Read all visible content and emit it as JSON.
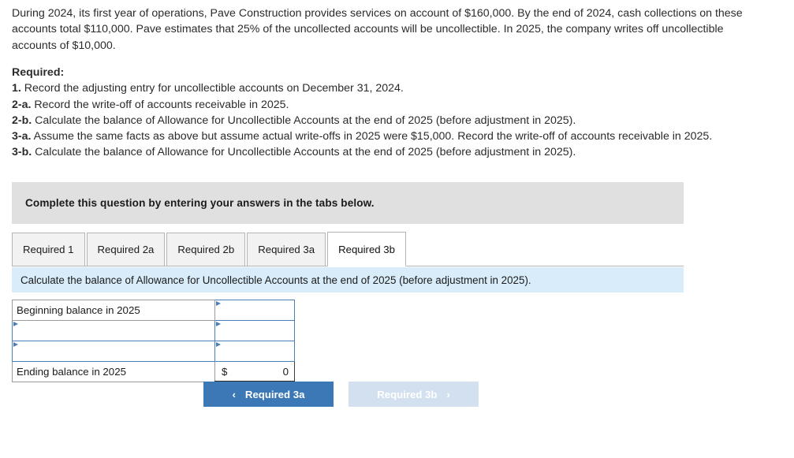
{
  "problem": {
    "text": "During 2024, its first year of operations, Pave Construction provides services on account of $160,000. By the end of 2024, cash collections on these accounts total $110,000. Pave estimates that 25% of the uncollected accounts will be uncollectible. In 2025, the company writes off uncollectible accounts of $10,000."
  },
  "required": {
    "heading": "Required:",
    "items": [
      {
        "num": "1.",
        "text": " Record the adjusting entry for uncollectible accounts on December 31, 2024."
      },
      {
        "num": "2-a.",
        "text": " Record the write-off of accounts receivable in 2025."
      },
      {
        "num": "2-b.",
        "text": " Calculate the balance of Allowance for Uncollectible Accounts at the end of 2025 (before adjustment in 2025)."
      },
      {
        "num": "3-a.",
        "text": " Assume the same facts as above but assume actual write-offs in 2025 were $15,000. Record the write-off of accounts receivable in 2025."
      },
      {
        "num": "3-b.",
        "text": " Calculate the balance of Allowance for Uncollectible Accounts at the end of 2025 (before adjustment in 2025)."
      }
    ]
  },
  "banner": {
    "text": "Complete this question by entering your answers in the tabs below."
  },
  "tabs": [
    {
      "label": "Required 1",
      "active": false
    },
    {
      "label": "Required 2a",
      "active": false
    },
    {
      "label": "Required 2b",
      "active": false
    },
    {
      "label": "Required 3a",
      "active": false
    },
    {
      "label": "Required 3b",
      "active": true
    }
  ],
  "question_bar": {
    "text": "Calculate the balance of Allowance for Uncollectible Accounts at the end of 2025 (before adjustment in 2025)."
  },
  "answer_table": {
    "rows": [
      {
        "label": "Beginning balance in 2025",
        "label_editable": false,
        "value": "",
        "value_editable": true,
        "is_total": false
      },
      {
        "label": "",
        "label_editable": true,
        "value": "",
        "value_editable": true,
        "is_total": false
      },
      {
        "label": "",
        "label_editable": true,
        "value": "",
        "value_editable": true,
        "is_total": false
      },
      {
        "label": "Ending balance in 2025",
        "label_editable": false,
        "value": "0",
        "currency": "$",
        "value_editable": false,
        "is_total": true
      }
    ]
  },
  "nav": {
    "prev_label": "Required 3a",
    "prev_chevron": "chevron-left",
    "prev_chevron_glyph": "‹",
    "next_label": "Required 3b",
    "next_chevron": "chevron-right",
    "next_chevron_glyph": "›",
    "next_disabled": true
  },
  "colors": {
    "accent_blue": "#3b78b5",
    "disabled_blue": "#d3e0ef",
    "question_bar_blue": "#d9ecf9",
    "banner_gray": "#e0e0e0",
    "cell_border_blue": "#4a7ebb"
  }
}
